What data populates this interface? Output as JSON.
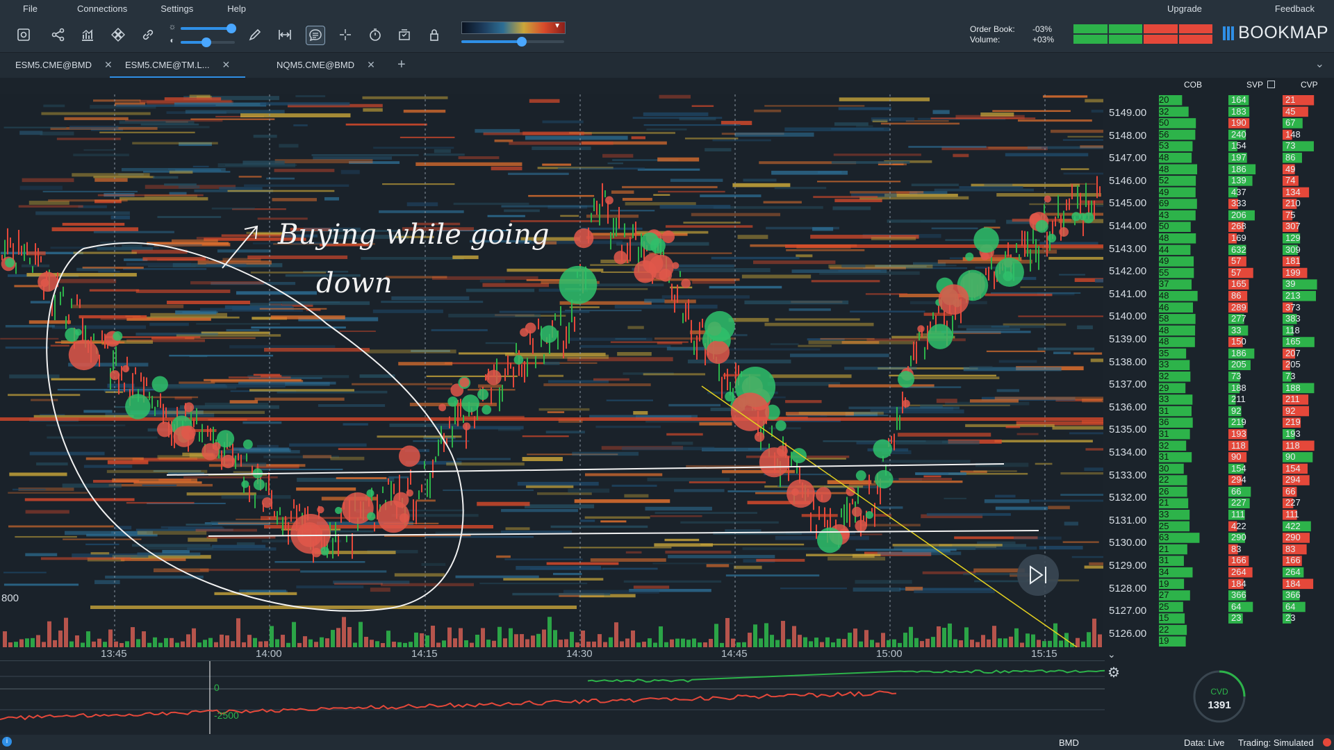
{
  "menu": {
    "file": "File",
    "connections": "Connections",
    "settings": "Settings",
    "help": "Help",
    "upgrade": "Upgrade",
    "feedback": "Feedback"
  },
  "toolbar": {
    "orderbook_label": "Order Book:",
    "orderbook_value": "-03%",
    "volume_label": "Volume:",
    "volume_value": "+03%",
    "logo": "BOOKMAP"
  },
  "tabs": [
    {
      "label": "ESM5.CME@BMD",
      "close": "✕"
    },
    {
      "label": "ESM5.CME@TM.L...",
      "close": "✕"
    },
    {
      "label": "NQM5.CME@BMD",
      "close": "✕"
    }
  ],
  "tabs_add": "+",
  "headers": {
    "cob": "COB",
    "svp": "SVP",
    "cvp": "CVP"
  },
  "prices": [
    "5149.00",
    "5148.00",
    "5147.00",
    "5146.00",
    "5145.00",
    "5144.00",
    "5143.00",
    "5142.00",
    "5141.00",
    "5140.00",
    "5139.00",
    "5138.00",
    "5137.00",
    "5136.00",
    "5135.00",
    "5134.00",
    "5133.00",
    "5132.00",
    "5131.00",
    "5130.00",
    "5129.00",
    "5128.00",
    "5127.00",
    "5126.00"
  ],
  "cob": [
    "20",
    "32",
    "50",
    "56",
    "53",
    "48",
    "48",
    "52",
    "49",
    "69",
    "43",
    "50",
    "48",
    "44",
    "49",
    "55",
    "37",
    "48",
    "46",
    "58",
    "48",
    "48",
    "35",
    "33",
    "32",
    "29",
    "33",
    "31",
    "36",
    "31",
    "32",
    "31",
    "30",
    "22",
    "26",
    "21",
    "33",
    "25",
    "63",
    "21",
    "31",
    "34",
    "19",
    "27",
    "25",
    "15",
    "22",
    "19"
  ],
  "svp": [
    "164",
    "183",
    "190",
    "240",
    "154",
    "197",
    "186",
    "139",
    "437",
    "333",
    "206",
    "268",
    "169",
    "632",
    "57",
    "57",
    "165",
    "86",
    "289",
    "277",
    "33",
    "150",
    "186",
    "205",
    "73",
    "188",
    "211",
    "92",
    "219",
    "193",
    "118",
    "90",
    "154",
    "294",
    "66",
    "227",
    "111",
    "422",
    "290",
    "83",
    "166",
    "264",
    "184",
    "366",
    "64",
    "23"
  ],
  "cvp": [
    "21",
    "45",
    "67",
    "148",
    "73",
    "86",
    "49",
    "74",
    "134",
    "210",
    "75",
    "307",
    "129",
    "309",
    "181",
    "199",
    "39",
    "213",
    "373",
    "383",
    "118",
    "165",
    "207",
    "205",
    "73",
    "188",
    "211",
    "92",
    "219",
    "193",
    "118",
    "90",
    "154",
    "294",
    "66",
    "227",
    "111",
    "422",
    "290",
    "83",
    "166",
    "264",
    "184",
    "366",
    "64",
    "23"
  ],
  "time_labels": [
    "13:45",
    "14:00",
    "14:15",
    "14:30",
    "14:45",
    "15:00",
    "15:15"
  ],
  "left_label": "800",
  "cvd": {
    "zero": "0",
    "neg": "-2500",
    "gauge_label": "CVD",
    "gauge_value": "1391"
  },
  "annotation": {
    "line1": "Buying while going",
    "line2": "down"
  },
  "status": {
    "bmd": "BMD",
    "data": "Data: Live",
    "trading": "Trading: Simulated"
  },
  "colors": {
    "accent": "#2f8fe6",
    "bid": "#2db34a",
    "ask": "#e5483a",
    "bg": "#1b232b"
  }
}
